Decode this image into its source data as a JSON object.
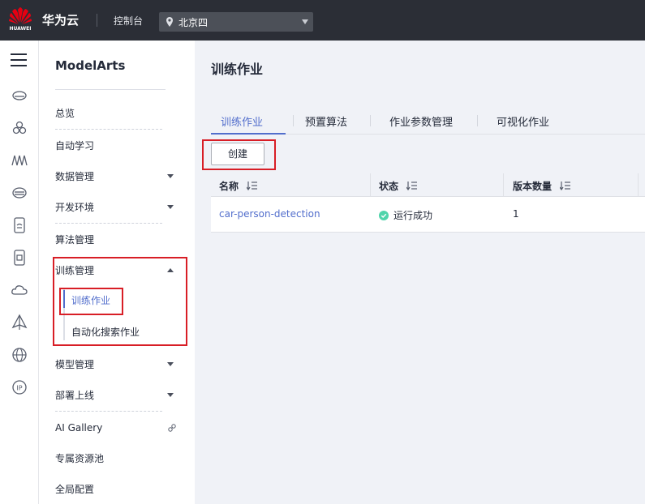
{
  "header": {
    "logo_text": "HUAWEI",
    "brand": "华为云",
    "console": "控制台",
    "region": "北京四"
  },
  "rail": {
    "icons": [
      "menu-icon",
      "cloud-server-icon",
      "cluster-icon",
      "ai-icon",
      "storage-icon",
      "database-icon",
      "security-icon",
      "cloud-icon",
      "deploy-icon",
      "globe-icon",
      "ip-icon"
    ]
  },
  "sidebar": {
    "title": "ModelArts",
    "items": [
      {
        "label": "总览"
      },
      {
        "label": "自动学习"
      },
      {
        "label": "数据管理"
      },
      {
        "label": "开发环境"
      },
      {
        "label": "算法管理"
      },
      {
        "label": "训练管理"
      },
      {
        "label": "模型管理"
      },
      {
        "label": "部署上线"
      },
      {
        "label": "AI Gallery"
      },
      {
        "label": "专属资源池"
      },
      {
        "label": "全局配置"
      }
    ],
    "training_sub": [
      {
        "label": "训练作业"
      },
      {
        "label": "自动化搜索作业"
      }
    ]
  },
  "main": {
    "title": "训练作业",
    "tabs": [
      {
        "label": "训练作业"
      },
      {
        "label": "预置算法"
      },
      {
        "label": "作业参数管理"
      },
      {
        "label": "可视化作业"
      }
    ],
    "create_label": "创建",
    "columns": [
      "名称",
      "状态",
      "版本数量"
    ],
    "rows": [
      {
        "name": "car-person-detection",
        "status": "运行成功",
        "versions": "1"
      }
    ]
  },
  "colors": {
    "topbar": "#2b2e36",
    "accent": "#526ecc",
    "success": "#50d4ab",
    "highlight": "#d81e26"
  }
}
